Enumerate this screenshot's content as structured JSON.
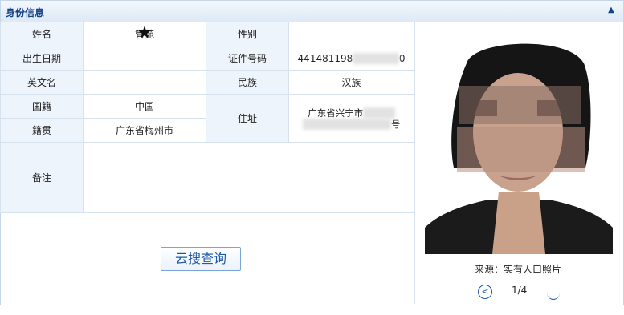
{
  "panel": {
    "title": "身份信息",
    "collapse_icon": "chevron-up-icon"
  },
  "fields": {
    "name_label": "姓名",
    "name_value": "管苑",
    "gender_label": "性别",
    "gender_value": "",
    "birth_label": "出生日期",
    "birth_value": "",
    "id_label": "证件号码",
    "id_value_start": "441481198",
    "id_value_end": "0",
    "en_name_label": "英文名",
    "en_name_value": "",
    "ethnicity_label": "民族",
    "ethnicity_value": "汉族",
    "nationality_label": "国籍",
    "nationality_value": "中国",
    "address_label": "住址",
    "address_line1": "广东省兴宁市",
    "address_line2": "号",
    "native_label": "籍贯",
    "native_value": "广东省梅州市",
    "remark_label": "备注",
    "remark_value": ""
  },
  "search_button": {
    "label": "云搜查询"
  },
  "photo": {
    "source_text": "来源：实有人口照片",
    "page_text": "1/4",
    "prev_icon": "prev-icon",
    "next_icon": "next-icon"
  }
}
